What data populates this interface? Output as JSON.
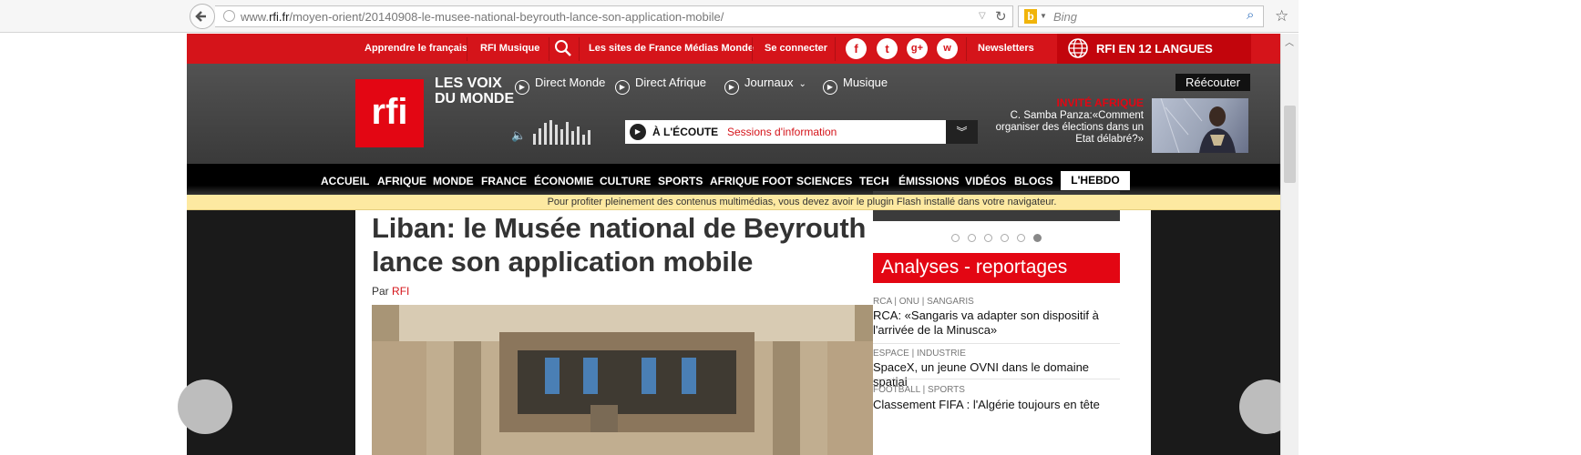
{
  "browser": {
    "url_prefix": "www.",
    "url_domain": "rfi.fr",
    "url_path": "/moyen-orient/20140908-le-musee-national-beyrouth-lance-son-application-mobile/",
    "search_placeholder": "Bing"
  },
  "topbar": {
    "links": [
      "Apprendre le français",
      "RFI Musique",
      "Les sites de France Médias Monde",
      "Se connecter",
      "Newsletters"
    ],
    "social": [
      "f",
      "t",
      "g+",
      "w"
    ],
    "lang": "RFI EN 12 LANGUES"
  },
  "header": {
    "logo": "rfi",
    "tagline_1": "LES VOIX",
    "tagline_2": "DU MONDE",
    "audio_nav": [
      "Direct Monde",
      "Direct Afrique",
      "Journaux",
      "Musique"
    ],
    "reecouter": "Réécouter",
    "ecoute_label": "À L'ÉCOUTE",
    "ecoute_value": "Sessions d'information",
    "invite_label": "INVITÉ AFRIQUE",
    "invite_text": "C. Samba Panza:«Comment organiser des élections dans un Etat délabré?»"
  },
  "nav": {
    "items": [
      "ACCUEIL",
      "AFRIQUE",
      "MONDE",
      "FRANCE",
      "ÉCONOMIE",
      "CULTURE",
      "SPORTS",
      "AFRIQUE FOOT",
      "SCIENCES",
      "TECH",
      "ÉMISSIONS",
      "VIDÉOS",
      "BLOGS"
    ],
    "hebdo": "L'HEBDO"
  },
  "flash_notice": "Pour profiter pleinement des contenus multimédias, vous devez avoir le plugin Flash installé dans votre navigateur.",
  "article": {
    "title": "Liban: le Musée national de Beyrouth lance son application mobile",
    "byline_prefix": "Par",
    "byline_author": "RFI"
  },
  "sidebar": {
    "section_title": "Analyses - reportages",
    "items": [
      {
        "meta": "RCA | ONU | SANGARIS",
        "title": "RCA: «Sangaris va adapter son dispositif à l'arrivée de la Minusca»"
      },
      {
        "meta": "ESPACE | INDUSTRIE",
        "title": "SpaceX, un jeune OVNI dans le domaine spatial"
      },
      {
        "meta": "FOOTBALL | SPORTS",
        "title": "Classement FIFA : l'Algérie toujours en tête"
      }
    ]
  }
}
